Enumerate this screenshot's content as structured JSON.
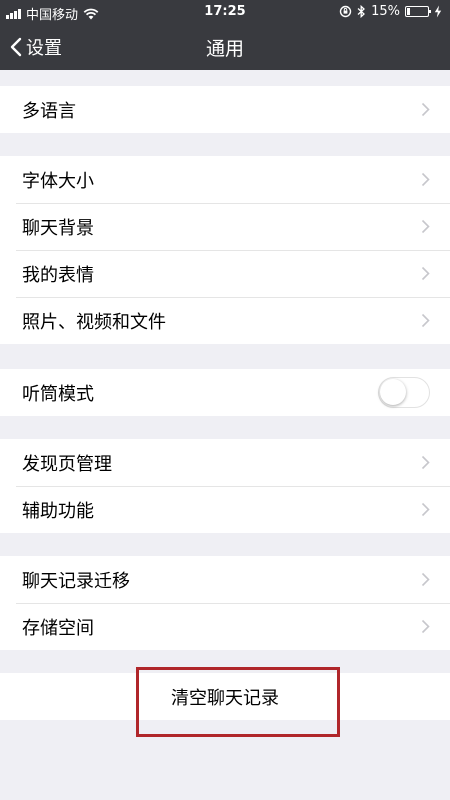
{
  "status_bar": {
    "carrier": "中国移动",
    "time": "17:25",
    "battery_percent_text": "15%",
    "battery_level": 0.15
  },
  "nav": {
    "back_label": "设置",
    "title": "通用"
  },
  "groups": {
    "language": {
      "label": "多语言"
    },
    "display": {
      "font_size": "字体大小",
      "chat_background": "聊天背景",
      "my_stickers": "我的表情",
      "media": "照片、视频和文件"
    },
    "earpiece": {
      "label": "听筒模式",
      "enabled": false
    },
    "discover": {
      "discover_manage": "发现页管理",
      "accessibility": "辅助功能"
    },
    "storage": {
      "chat_migration": "聊天记录迁移",
      "storage_space": "存储空间"
    },
    "clear": {
      "label": "清空聊天记录"
    }
  },
  "colors": {
    "nav_bg": "#393a3f",
    "page_bg": "#efeff4",
    "highlight": "#b0262a"
  }
}
